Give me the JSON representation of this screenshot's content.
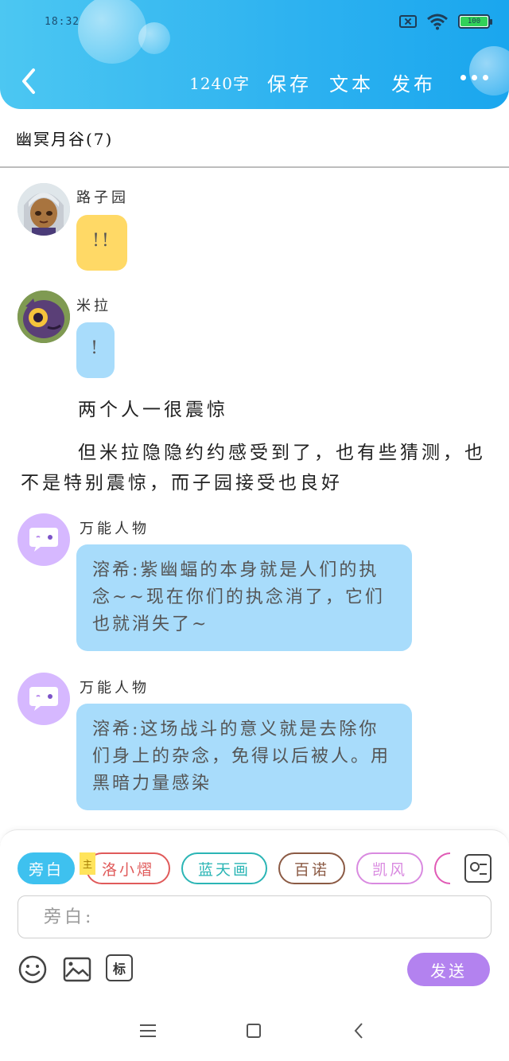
{
  "status_bar": {
    "time": "18:32",
    "battery": "100"
  },
  "header": {
    "word_count": "1240字",
    "save_label": "保存",
    "text_label": "文本",
    "publish_label": "发布",
    "colors": {
      "gradient_start": "#4cc7f2",
      "gradient_end": "#1aa6ee"
    }
  },
  "group": {
    "title": "幽冥月谷(7)"
  },
  "messages": [
    {
      "name": "路子园",
      "text": "!!",
      "bubble_color": "#ffd966"
    },
    {
      "name": "米拉",
      "text": "!",
      "bubble_color": "#a8dcfb"
    }
  ],
  "narrations": [
    "两个人一很震惊",
    "但米拉隐隐约约感受到了，也有些猜测，也不是特别震惊，而子园接受也良好"
  ],
  "ai_messages": [
    {
      "name": "万能人物",
      "text": "溶希:紫幽蝠的本身就是人们的执念~~现在你们的执念消了，它们也就消失了~"
    },
    {
      "name": "万能人物",
      "text": "溶希:这场战斗的意义就是去除你们身上的杂念，免得以后被人。用黑暗力量感染"
    }
  ],
  "roles": [
    {
      "label": "旁白",
      "color": "#3ec1ef",
      "active": true
    },
    {
      "label": "洛小熠",
      "color": "#e05a5a",
      "active": false
    },
    {
      "label": "蓝天画",
      "color": "#2bb5b5",
      "active": false
    },
    {
      "label": "百诺",
      "color": "#8b5a44",
      "active": false
    },
    {
      "label": "凯风",
      "color": "#d98ae0",
      "active": false
    }
  ],
  "main_tag": "主",
  "input": {
    "placeholder": "旁白:"
  },
  "tools": {
    "marker_label": "标",
    "send_label": "发送",
    "send_color": "#b382ef"
  }
}
